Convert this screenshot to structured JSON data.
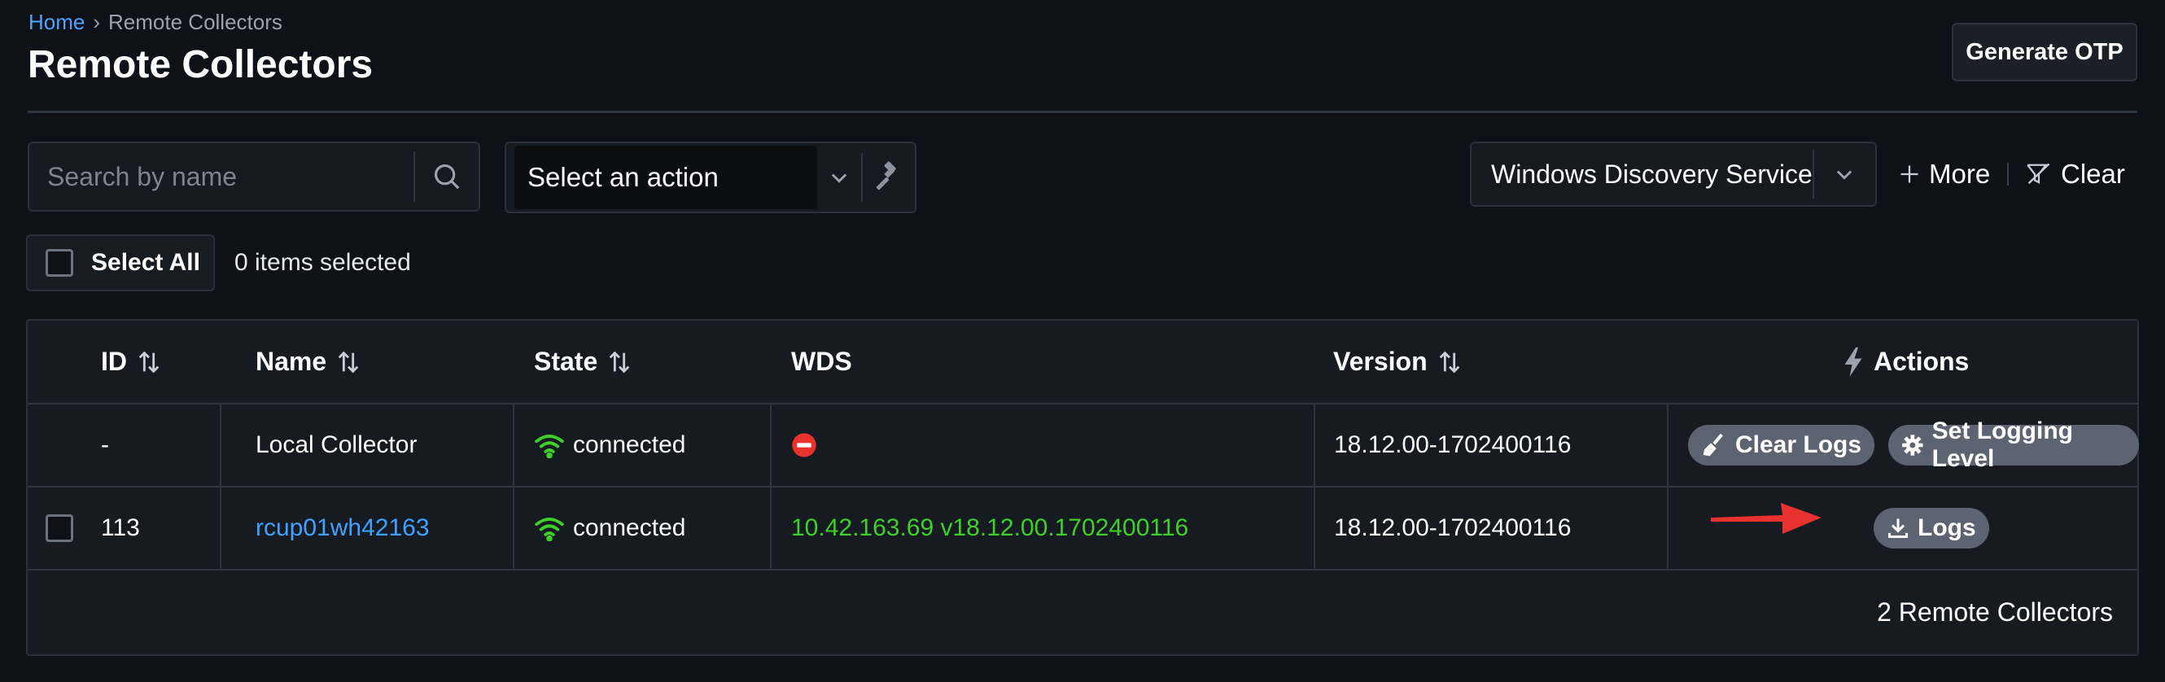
{
  "breadcrumb": {
    "home": "Home",
    "separator": "›",
    "current": "Remote Collectors"
  },
  "header": {
    "title": "Remote Collectors",
    "generate_otp": "Generate OTP"
  },
  "toolbar": {
    "search_placeholder": "Search by name",
    "action_select": "Select an action",
    "filter_value": "Windows Discovery Service",
    "more_label": "More",
    "clear_label": "Clear"
  },
  "selection": {
    "select_all": "Select All",
    "items_selected": "0 items selected"
  },
  "table": {
    "columns": {
      "id": "ID",
      "name": "Name",
      "state": "State",
      "wds": "WDS",
      "version": "Version",
      "actions": "Actions"
    },
    "rows": [
      {
        "id": "-",
        "name": "Local Collector",
        "state": "connected",
        "wds": "",
        "wds_status": "blocked-icon",
        "version": "18.12.00-1702400116",
        "actions": [
          "Clear Logs",
          "Set Logging Level"
        ]
      },
      {
        "id": "113",
        "name": "rcup01wh42163",
        "state": "connected",
        "wds": "10.42.163.69 v18.12.00.1702400116",
        "version": "18.12.00-1702400116",
        "actions": [
          "Logs"
        ]
      }
    ],
    "footer": "2 Remote Collectors"
  },
  "colors": {
    "link": "#3fa2ff",
    "connected": "#3ecf28",
    "accent_red": "#e8322e",
    "pill": "#5b6470"
  }
}
